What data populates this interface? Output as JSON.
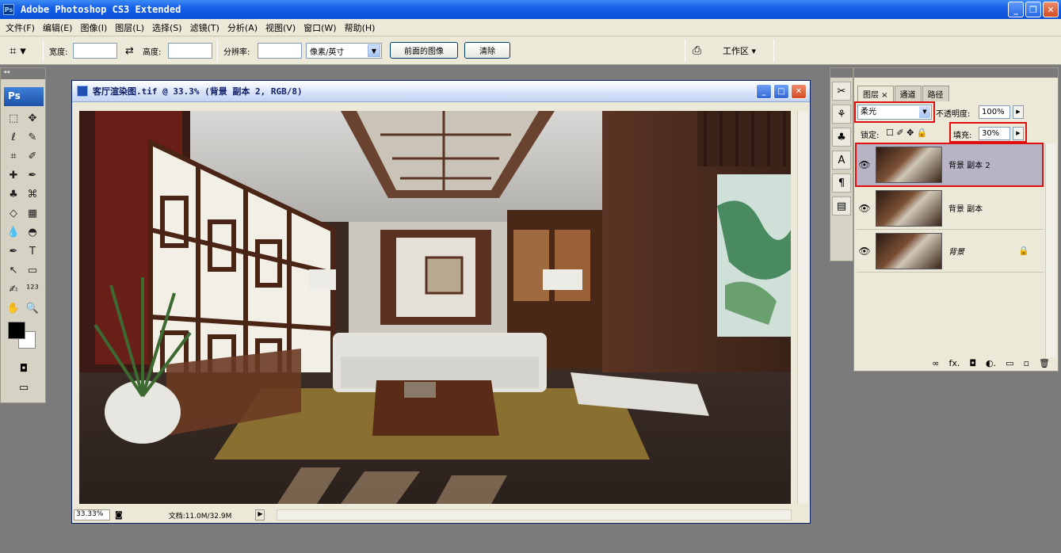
{
  "app": {
    "title": "Adobe Photoshop CS3 Extended",
    "icon_label": "Ps",
    "window_buttons": [
      "_",
      "❐",
      "✕"
    ]
  },
  "menu": [
    "文件(F)",
    "编辑(E)",
    "图像(I)",
    "图层(L)",
    "选择(S)",
    "滤镜(T)",
    "分析(A)",
    "视图(V)",
    "窗口(W)",
    "帮助(H)"
  ],
  "options": {
    "tool_icon": "crop-icon",
    "width_label": "宽度:",
    "width_value": "",
    "swap_icon": "⇄",
    "height_label": "高度:",
    "height_value": "",
    "resolution_label": "分辨率:",
    "resolution_value": "",
    "unit_select": "像素/英寸",
    "front_image_button": "前面的图像",
    "clear_button": "清除",
    "workspace_label": "工作区 ▾"
  },
  "toolbox": {
    "logo": "Ps",
    "tools": [
      {
        "glyph": "⬚",
        "name": "marquee-tool-icon"
      },
      {
        "glyph": "✥",
        "name": "move-tool-icon"
      },
      {
        "glyph": "ℓ",
        "name": "lasso-tool-icon"
      },
      {
        "glyph": "✎",
        "name": "magic-wand-icon"
      },
      {
        "glyph": "⌗",
        "name": "crop-tool-icon"
      },
      {
        "glyph": "✐",
        "name": "slice-tool-icon"
      },
      {
        "glyph": "✚",
        "name": "healing-brush-icon"
      },
      {
        "glyph": "✒",
        "name": "brush-tool-icon"
      },
      {
        "glyph": "♣",
        "name": "clone-stamp-icon"
      },
      {
        "glyph": "⌘",
        "name": "history-brush-icon"
      },
      {
        "glyph": "◇",
        "name": "eraser-tool-icon"
      },
      {
        "glyph": "▦",
        "name": "gradient-tool-icon"
      },
      {
        "glyph": "💧",
        "name": "blur-tool-icon"
      },
      {
        "glyph": "◓",
        "name": "dodge-tool-icon"
      },
      {
        "glyph": "✒",
        "name": "pen-tool-icon"
      },
      {
        "glyph": "T",
        "name": "type-tool-icon"
      },
      {
        "glyph": "↖",
        "name": "path-select-icon"
      },
      {
        "glyph": "▭",
        "name": "shape-tool-icon"
      },
      {
        "glyph": "✍",
        "name": "notes-tool-icon"
      },
      {
        "glyph": "¹²³",
        "name": "count-tool-icon"
      },
      {
        "glyph": "✋",
        "name": "hand-tool-icon"
      },
      {
        "glyph": "🔍",
        "name": "zoom-tool-icon"
      }
    ]
  },
  "document": {
    "title": "客厅渲染图.tif @ 33.3% (背景 副本 2, RGB/8)",
    "zoom": "33.33%",
    "doc_size": "文档:11.0M/32.9M",
    "status_arrow": "▶"
  },
  "layers_panel": {
    "tabs": [
      "图层 ×",
      "通道",
      "路径"
    ],
    "blend_mode": "柔光",
    "opacity_label": "不透明度:",
    "opacity_value": "100%",
    "lock_label": "锁定:",
    "lock_icons": "☐ ✐ ✥ 🔒",
    "fill_label": "填充:",
    "fill_value": "30%",
    "layers": [
      {
        "name": "背景 副本 2",
        "selected": true,
        "locked": false
      },
      {
        "name": "背景 副本",
        "selected": false,
        "locked": false
      },
      {
        "name": "背景",
        "selected": false,
        "locked": true
      }
    ],
    "footer_icons": [
      "∞",
      "fx.",
      "◘",
      "◐.",
      "▭",
      "▫",
      "🗑"
    ]
  },
  "highlight_color": "#e01010"
}
